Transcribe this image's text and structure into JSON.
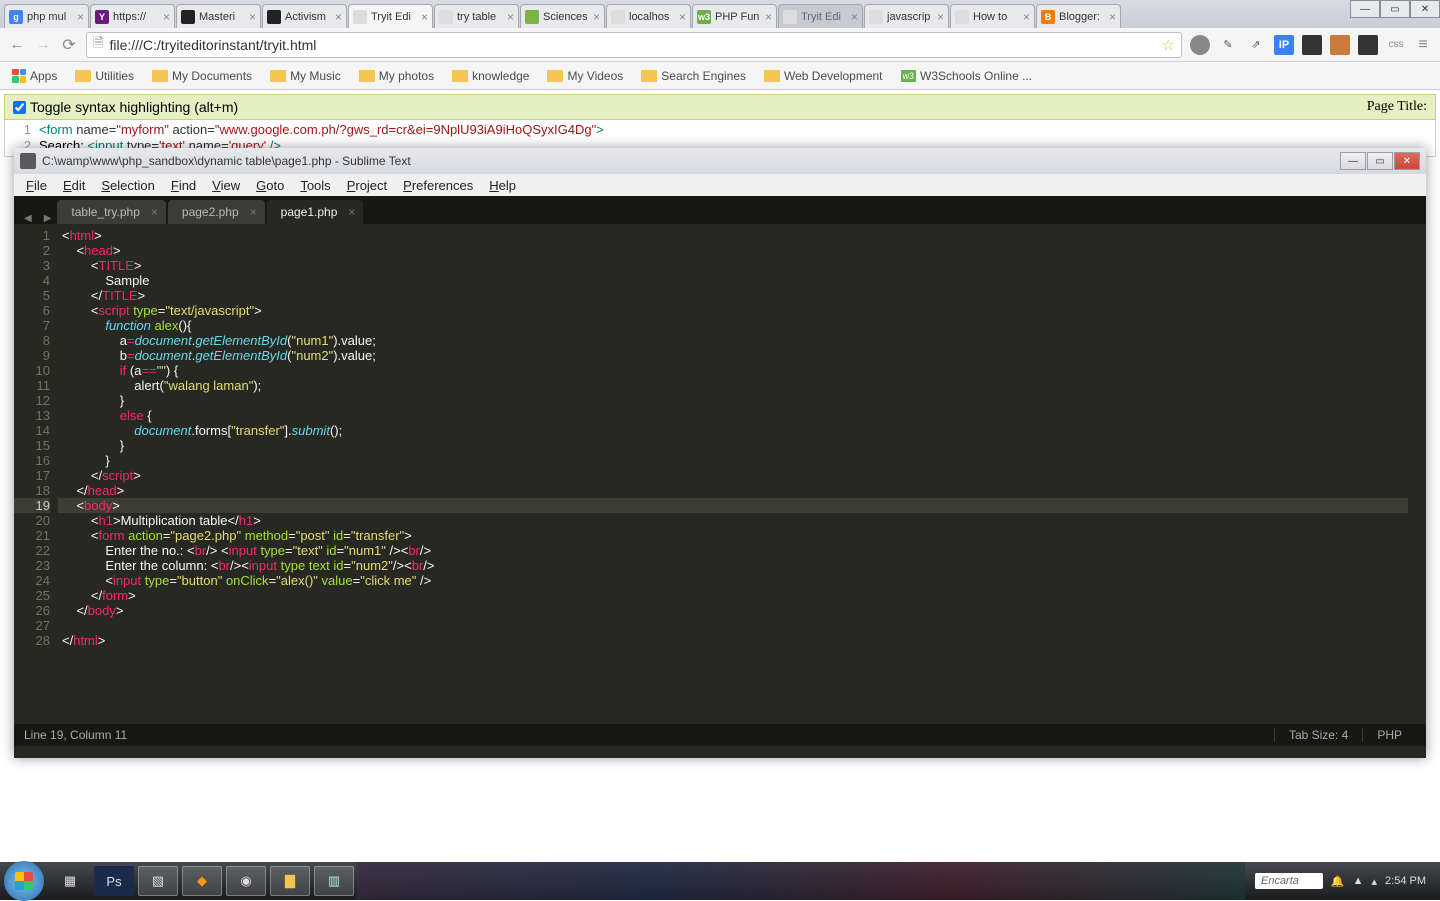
{
  "chrome": {
    "tabs": [
      {
        "label": "php mul",
        "fav": "g",
        "favbg": "#4285f4"
      },
      {
        "label": "https://",
        "fav": "Y",
        "favbg": "#6b1b7f"
      },
      {
        "label": "Masteri",
        "fav": "",
        "favbg": "#222"
      },
      {
        "label": "Activism",
        "fav": "",
        "favbg": "#222"
      },
      {
        "label": "Tryit Edi",
        "fav": "",
        "favbg": "#ddd",
        "active": true
      },
      {
        "label": "try table",
        "fav": "",
        "favbg": "#ddd"
      },
      {
        "label": "Sciences",
        "fav": "",
        "favbg": "#7cb342"
      },
      {
        "label": "localhos",
        "fav": "",
        "favbg": "#ddd"
      },
      {
        "label": "PHP Fun",
        "fav": "w3",
        "favbg": "#6ab04c"
      },
      {
        "label": "Tryit Edi",
        "fav": "",
        "favbg": "#ddd",
        "dim": true
      },
      {
        "label": "javascrip",
        "fav": "",
        "favbg": "#ddd"
      },
      {
        "label": "How to",
        "fav": "",
        "favbg": "#ddd"
      },
      {
        "label": "Blogger:",
        "fav": "B",
        "favbg": "#f57c00"
      }
    ],
    "url": "file:///C:/tryiteditorinstant/tryit.html",
    "bookmarks": [
      "Apps",
      "Utilities",
      "My Documents",
      "My Music",
      "My photos",
      "knowledge",
      "My Videos",
      "Search Engines",
      "Web Development",
      "W3Schools Online ..."
    ]
  },
  "tryit": {
    "toggle_label": "Toggle syntax highlighting (alt+m)",
    "page_title_label": "Page Title:",
    "line1_html": "<span class='c-tag'>&lt;form</span> <span class='c-attr'>name=</span><span class='c-str'>\"myform\"</span>  <span class='c-attr'>action=</span><span class='c-str'>\"www.google.com.ph/?gws_rd=cr&amp;ei=9NplU93iA9iHoQSyxIG4Dg\"</span><span class='c-tag'>&gt;</span>",
    "line2_html": "Search: <span class='c-tag'>&lt;input</span> <span class='c-attr'>type=</span><span class='c-str'>'text'</span> <span class='c-attr'>name=</span><span class='c-str'>'query'</span> <span class='c-tag'>/&gt;</span>"
  },
  "sublime": {
    "title": "C:\\wamp\\www\\php_sandbox\\dynamic table\\page1.php - Sublime Text",
    "menu": [
      "File",
      "Edit",
      "Selection",
      "Find",
      "View",
      "Goto",
      "Tools",
      "Project",
      "Preferences",
      "Help"
    ],
    "tabs": [
      {
        "label": "table_try.php"
      },
      {
        "label": "page2.php"
      },
      {
        "label": "page1.php",
        "active": true
      }
    ],
    "status_left": "Line 19, Column 11",
    "status_tabsize": "Tab Size: 4",
    "status_lang": "PHP",
    "line_count": 28,
    "highlighted_line": 19
  },
  "tray": {
    "encarta": "Encarta",
    "time": "2:54 PM"
  }
}
